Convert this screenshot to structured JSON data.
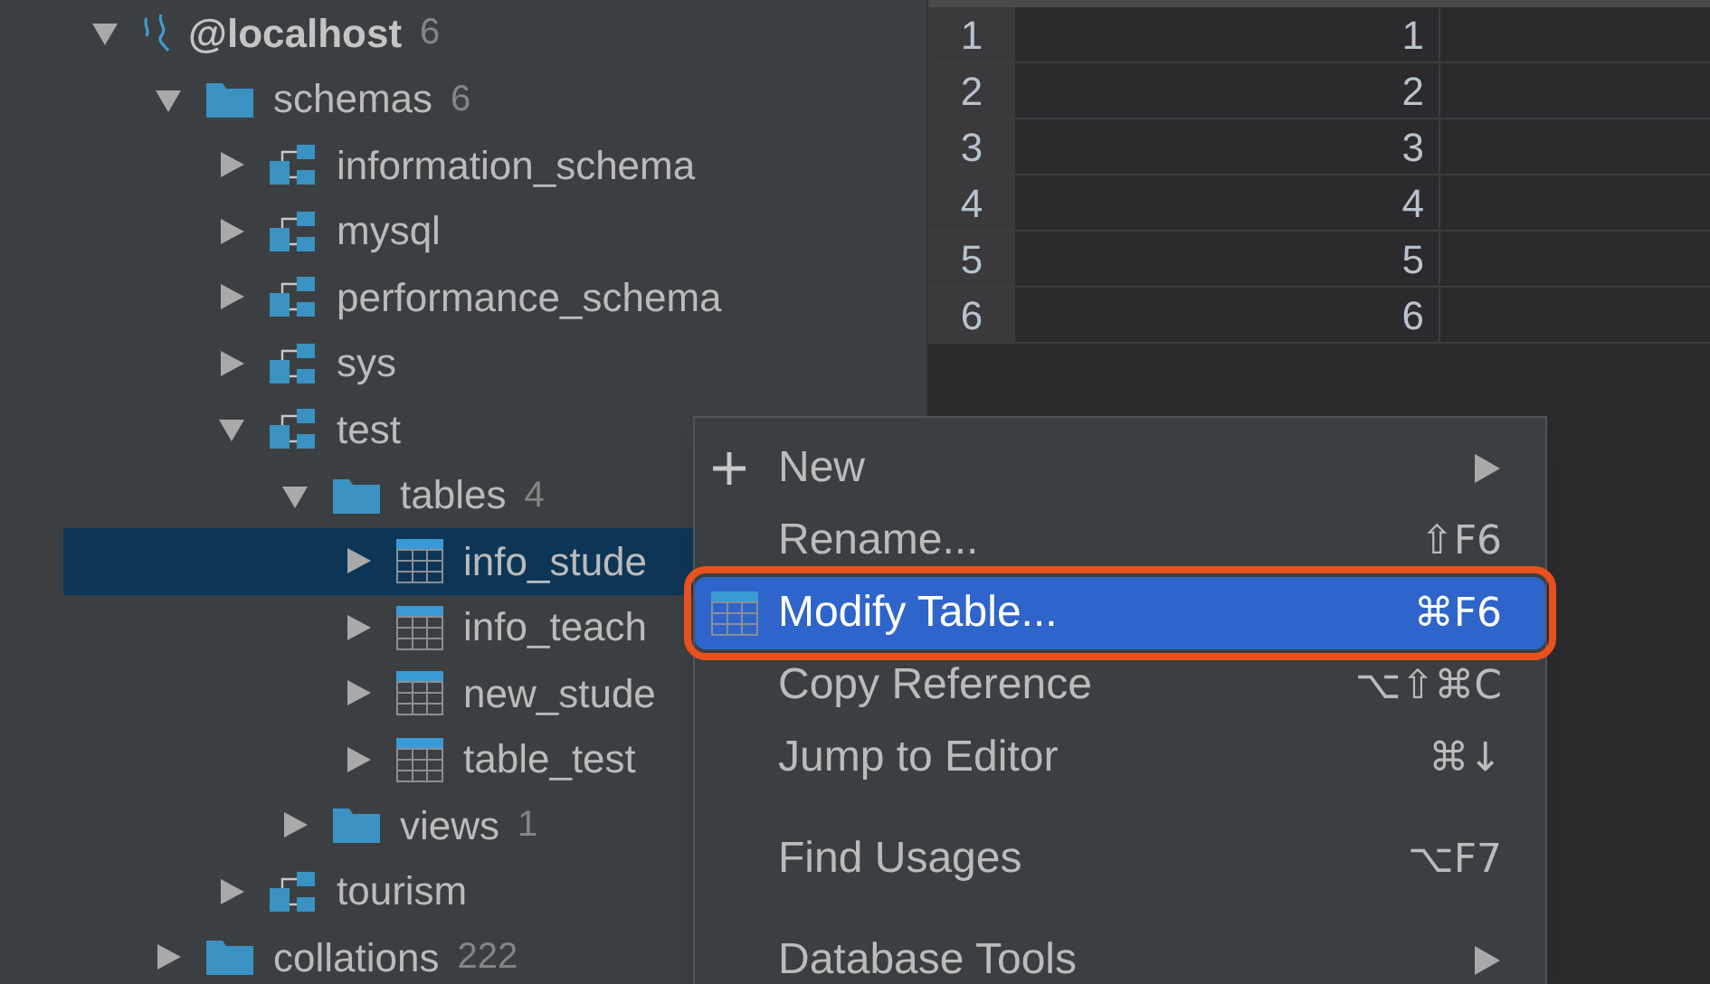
{
  "tree": [
    {
      "label": "@localhost",
      "count": "6",
      "kind": "connection",
      "expanded": true,
      "selected": false,
      "children": [
        {
          "label": "schemas",
          "count": "6",
          "kind": "folder",
          "expanded": true,
          "selected": false,
          "children": [
            {
              "label": "information_schema",
              "kind": "schema",
              "expanded": false,
              "selected": false
            },
            {
              "label": "mysql",
              "kind": "schema",
              "expanded": false,
              "selected": false
            },
            {
              "label": "performance_schema",
              "kind": "schema",
              "expanded": false,
              "selected": false
            },
            {
              "label": "sys",
              "kind": "schema",
              "expanded": false,
              "selected": false
            },
            {
              "label": "test",
              "kind": "schema",
              "expanded": true,
              "selected": false,
              "children": [
                {
                  "label": "tables",
                  "count": "4",
                  "kind": "folder",
                  "expanded": true,
                  "selected": false,
                  "children": [
                    {
                      "label": "info_stude",
                      "kind": "table",
                      "expanded": false,
                      "selected": true
                    },
                    {
                      "label": "info_teach",
                      "kind": "table",
                      "expanded": false,
                      "selected": false
                    },
                    {
                      "label": "new_stude",
                      "kind": "table",
                      "expanded": false,
                      "selected": false
                    },
                    {
                      "label": "table_test",
                      "kind": "table",
                      "expanded": false,
                      "selected": false
                    }
                  ]
                },
                {
                  "label": "views",
                  "count": "1",
                  "kind": "folder",
                  "expanded": false,
                  "selected": false
                }
              ]
            },
            {
              "label": "tourism",
              "kind": "schema",
              "expanded": false,
              "selected": false
            }
          ]
        },
        {
          "label": "collations",
          "count": "222",
          "kind": "folder",
          "expanded": false,
          "selected": false
        }
      ]
    }
  ],
  "grid": {
    "rows": [
      {
        "number": "1",
        "value": "1"
      },
      {
        "number": "2",
        "value": "2"
      },
      {
        "number": "3",
        "value": "3"
      },
      {
        "number": "4",
        "value": "4"
      },
      {
        "number": "5",
        "value": "5"
      },
      {
        "number": "6",
        "value": "6"
      }
    ]
  },
  "context_menu": {
    "items": [
      {
        "kind": "item",
        "label": "New",
        "submenu": true,
        "selected": false,
        "callout": false
      },
      {
        "kind": "item",
        "label": "Rename...",
        "shortcut": "⇧F6",
        "submenu": false,
        "selected": false,
        "callout": false
      },
      {
        "kind": "item",
        "label": "Modify Table...",
        "shortcut": "⌘F6",
        "submenu": false,
        "selected": true,
        "callout": true
      },
      {
        "kind": "item",
        "label": "Copy Reference",
        "shortcut": "⌥⇧⌘C",
        "submenu": false,
        "selected": false,
        "callout": false
      },
      {
        "kind": "item",
        "label": "Jump to Editor",
        "shortcut": "⌘↓",
        "submenu": false,
        "selected": false,
        "callout": false
      },
      {
        "kind": "separator"
      },
      {
        "kind": "item",
        "label": "Find Usages",
        "shortcut": "⌥F7",
        "submenu": false,
        "selected": false,
        "callout": false
      },
      {
        "kind": "separator"
      },
      {
        "kind": "item",
        "label": "Database Tools",
        "submenu": true,
        "selected": false,
        "callout": false
      }
    ]
  }
}
